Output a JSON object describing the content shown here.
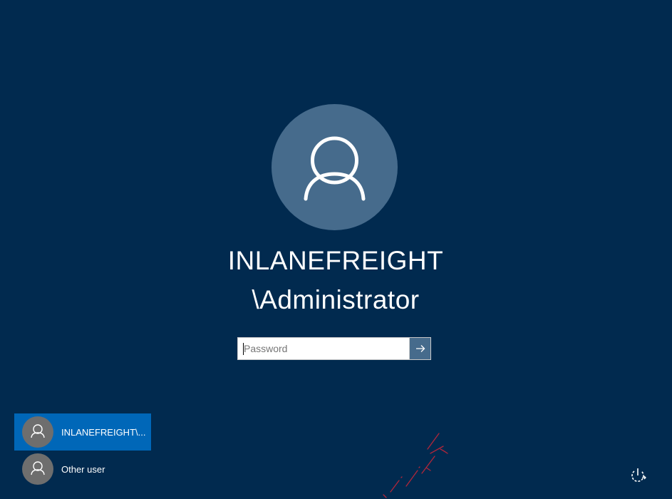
{
  "login": {
    "user_name_line1": "INLANEFREIGHT",
    "user_name_line2": "\\Administrator",
    "password_placeholder": "Password"
  },
  "user_list": [
    {
      "label": "INLANEFREIGHT\\...",
      "selected": true
    },
    {
      "label": "Other user",
      "selected": false
    }
  ],
  "icons": {
    "avatar": "user-silhouette-icon",
    "submit": "arrow-right-icon",
    "power": "power-icon"
  },
  "colors": {
    "background": "#012a4f",
    "avatar_bg": "#466b8c",
    "selected_user_bg": "#0067b8",
    "small_avatar_bg": "#6e6e6e"
  }
}
